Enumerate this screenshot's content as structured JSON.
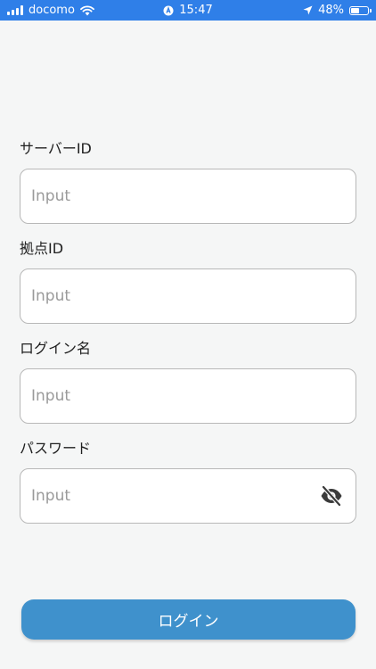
{
  "status_bar": {
    "carrier": "docomo",
    "time": "15:47",
    "battery": "48%",
    "battery_level": 0.48,
    "icons": [
      "signal-icon",
      "wifi-icon",
      "rotation-lock-icon",
      "location-arrow-icon",
      "battery-icon"
    ]
  },
  "form": {
    "server_id": {
      "label": "サーバーID",
      "placeholder": "Input",
      "value": ""
    },
    "site_id": {
      "label": "拠点ID",
      "placeholder": "Input",
      "value": ""
    },
    "login_name": {
      "label": "ログイン名",
      "placeholder": "Input",
      "value": ""
    },
    "password": {
      "label": "パスワード",
      "placeholder": "Input",
      "value": "",
      "toggle_icon": "eye-off-icon"
    }
  },
  "login_button": {
    "label": "ログイン"
  },
  "colors": {
    "status_bar": "#2f7fe8",
    "background": "#f5f6f6",
    "button": "#3f91cc",
    "input_border": "#b8b8b8",
    "placeholder": "#9a9a9a"
  }
}
